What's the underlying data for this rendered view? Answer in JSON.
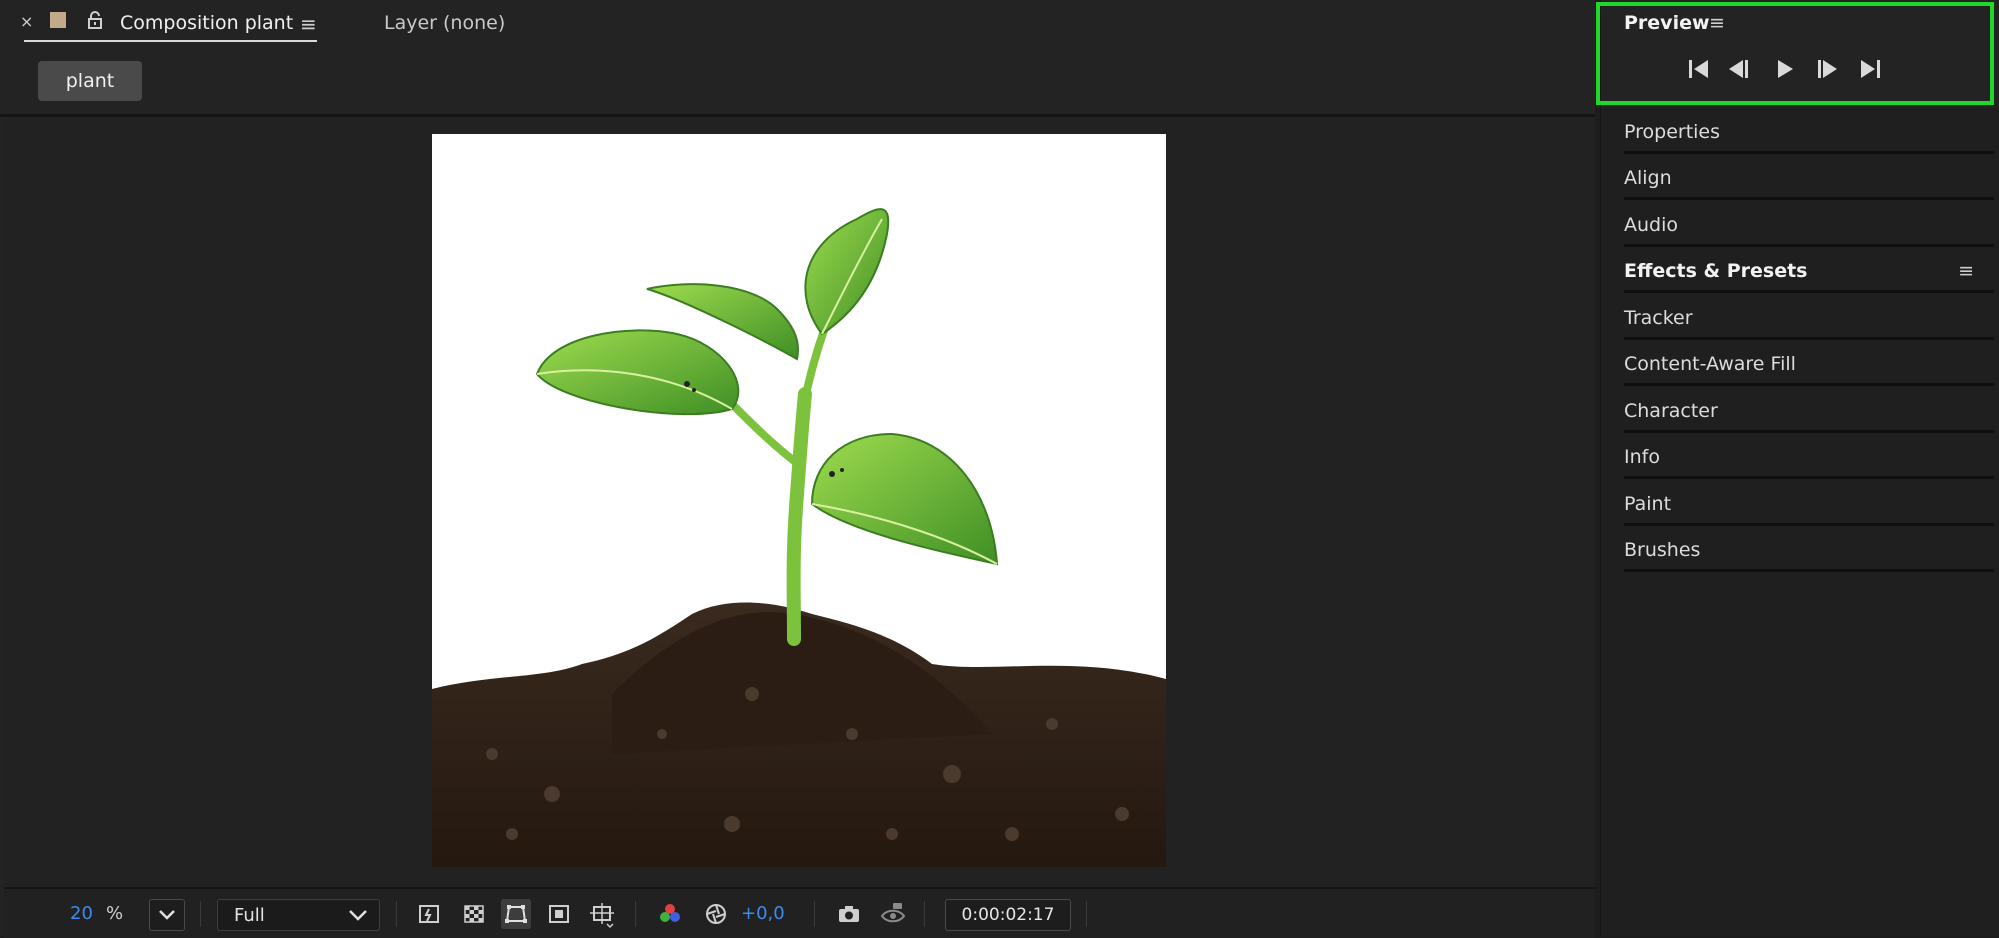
{
  "composition_panel": {
    "close_glyph": "×",
    "tab_title": "Composition plant",
    "menu_glyph": "≡",
    "layer_tab": "Layer (none)",
    "comp_name_button": "plant",
    "swatch_color": "#c2a98a"
  },
  "viewer_controls": {
    "zoom_value": "20",
    "zoom_unit": "%",
    "resolution": "Full",
    "exposure": "+0,0",
    "timecode": "0:00:02:17",
    "accent_color": "#3c8cf0"
  },
  "preview_panel": {
    "title": "Preview",
    "menu_glyph": "≡",
    "highlight_color": "#1fd82a",
    "buttons": [
      "first-frame-icon",
      "previous-frame-icon",
      "play-icon",
      "next-frame-icon",
      "last-frame-icon"
    ]
  },
  "panels": [
    {
      "label": "Properties"
    },
    {
      "label": "Align"
    },
    {
      "label": "Audio"
    },
    {
      "label": "Effects & Presets",
      "menu": "≡"
    },
    {
      "label": "Tracker"
    },
    {
      "label": "Content-Aware Fill"
    },
    {
      "label": "Character"
    },
    {
      "label": "Info"
    },
    {
      "label": "Paint"
    },
    {
      "label": "Brushes"
    }
  ]
}
